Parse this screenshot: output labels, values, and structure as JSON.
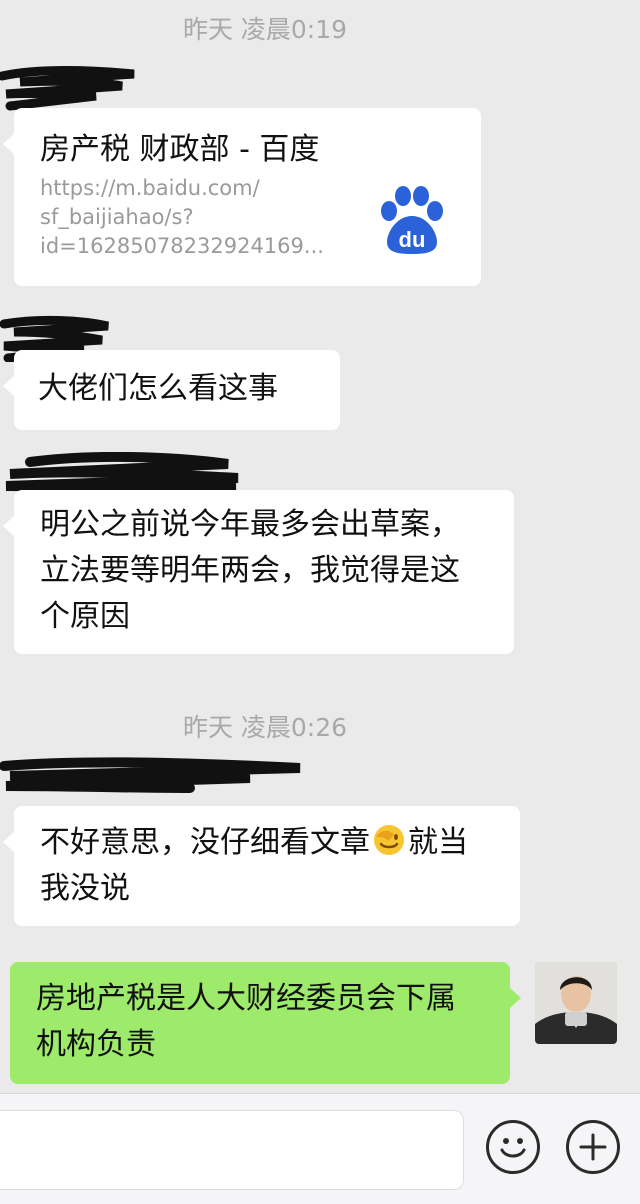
{
  "messages": {
    "timestamp_1": "昨天 凌晨0:19",
    "timestamp_2": "昨天 凌晨0:26",
    "link_card": {
      "title": "房产税 财政部 - 百度",
      "url_lines": [
        "https://m.baidu.com/",
        "sf_baijiahao/s?",
        "id=16285078232924169..."
      ],
      "logo_text": "du",
      "logo_color": "#2b62d9"
    },
    "msg_question": "大佬们怎么看这事",
    "msg_reason": "明公之前说今年最多会出草案，立法要等明年两会，我觉得是这个原因",
    "msg_sorry_before_emoji": "不好意思，没仔细看文章",
    "msg_sorry_after_emoji": "就当我没说",
    "msg_sorry_emoji": "facepalm-emoji",
    "msg_reply": "房地产税是人大财经委员会下属机构负责"
  },
  "colors": {
    "chat_bg": "#eaeaea",
    "incoming_bubble": "#ffffff",
    "outgoing_bubble": "#9eea6a",
    "timestamp": "#a9a9a9"
  },
  "composer": {
    "emoji_button": "smiley-icon",
    "more_button": "plus-icon"
  }
}
